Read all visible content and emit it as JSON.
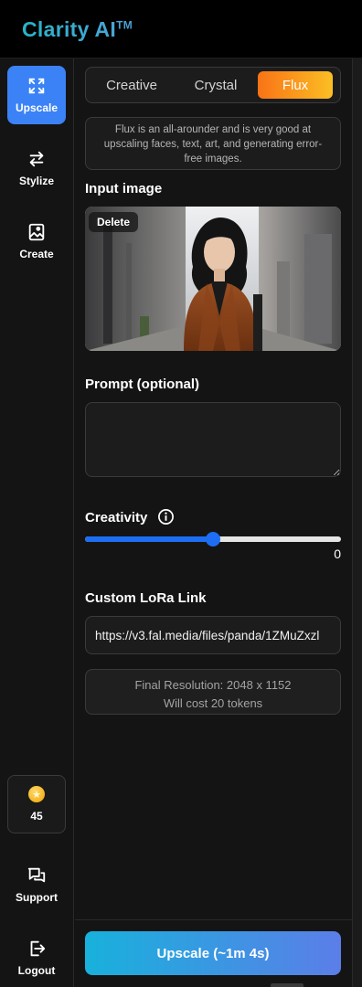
{
  "app": {
    "title": "Clarity AI",
    "trademark": "TM"
  },
  "sidebar": {
    "items": [
      {
        "label": "Upscale",
        "icon": "expand-arrows-icon",
        "active": true
      },
      {
        "label": "Stylize",
        "icon": "swap-arrows-icon",
        "active": false
      },
      {
        "label": "Create",
        "icon": "image-pen-icon",
        "active": false
      }
    ],
    "tokens": {
      "count": "45",
      "icon": "coin-star-icon"
    },
    "support_label": "Support",
    "logout_label": "Logout"
  },
  "modes": {
    "options": [
      "Creative",
      "Crystal",
      "Flux"
    ],
    "selected": "Flux",
    "accent": "#f97316"
  },
  "description": "Flux is an all-arounder and is very good at upscaling faces, text, art, and generating error-free images.",
  "input_image": {
    "heading": "Input image",
    "delete_label": "Delete"
  },
  "prompt": {
    "heading": "Prompt (optional)",
    "value": "",
    "placeholder": ""
  },
  "creativity": {
    "heading": "Creativity",
    "value": "0",
    "slider_fraction": 0.5,
    "accent": "#1d6ef3"
  },
  "lora": {
    "heading": "Custom LoRa Link",
    "value": "https://v3.fal.media/files/panda/1ZMuZxzl"
  },
  "resolution": {
    "line1": "Final Resolution: 2048 x 1152",
    "line2": "Will cost 20 tokens"
  },
  "cta": {
    "label": "Upscale (~1m 4s)"
  }
}
